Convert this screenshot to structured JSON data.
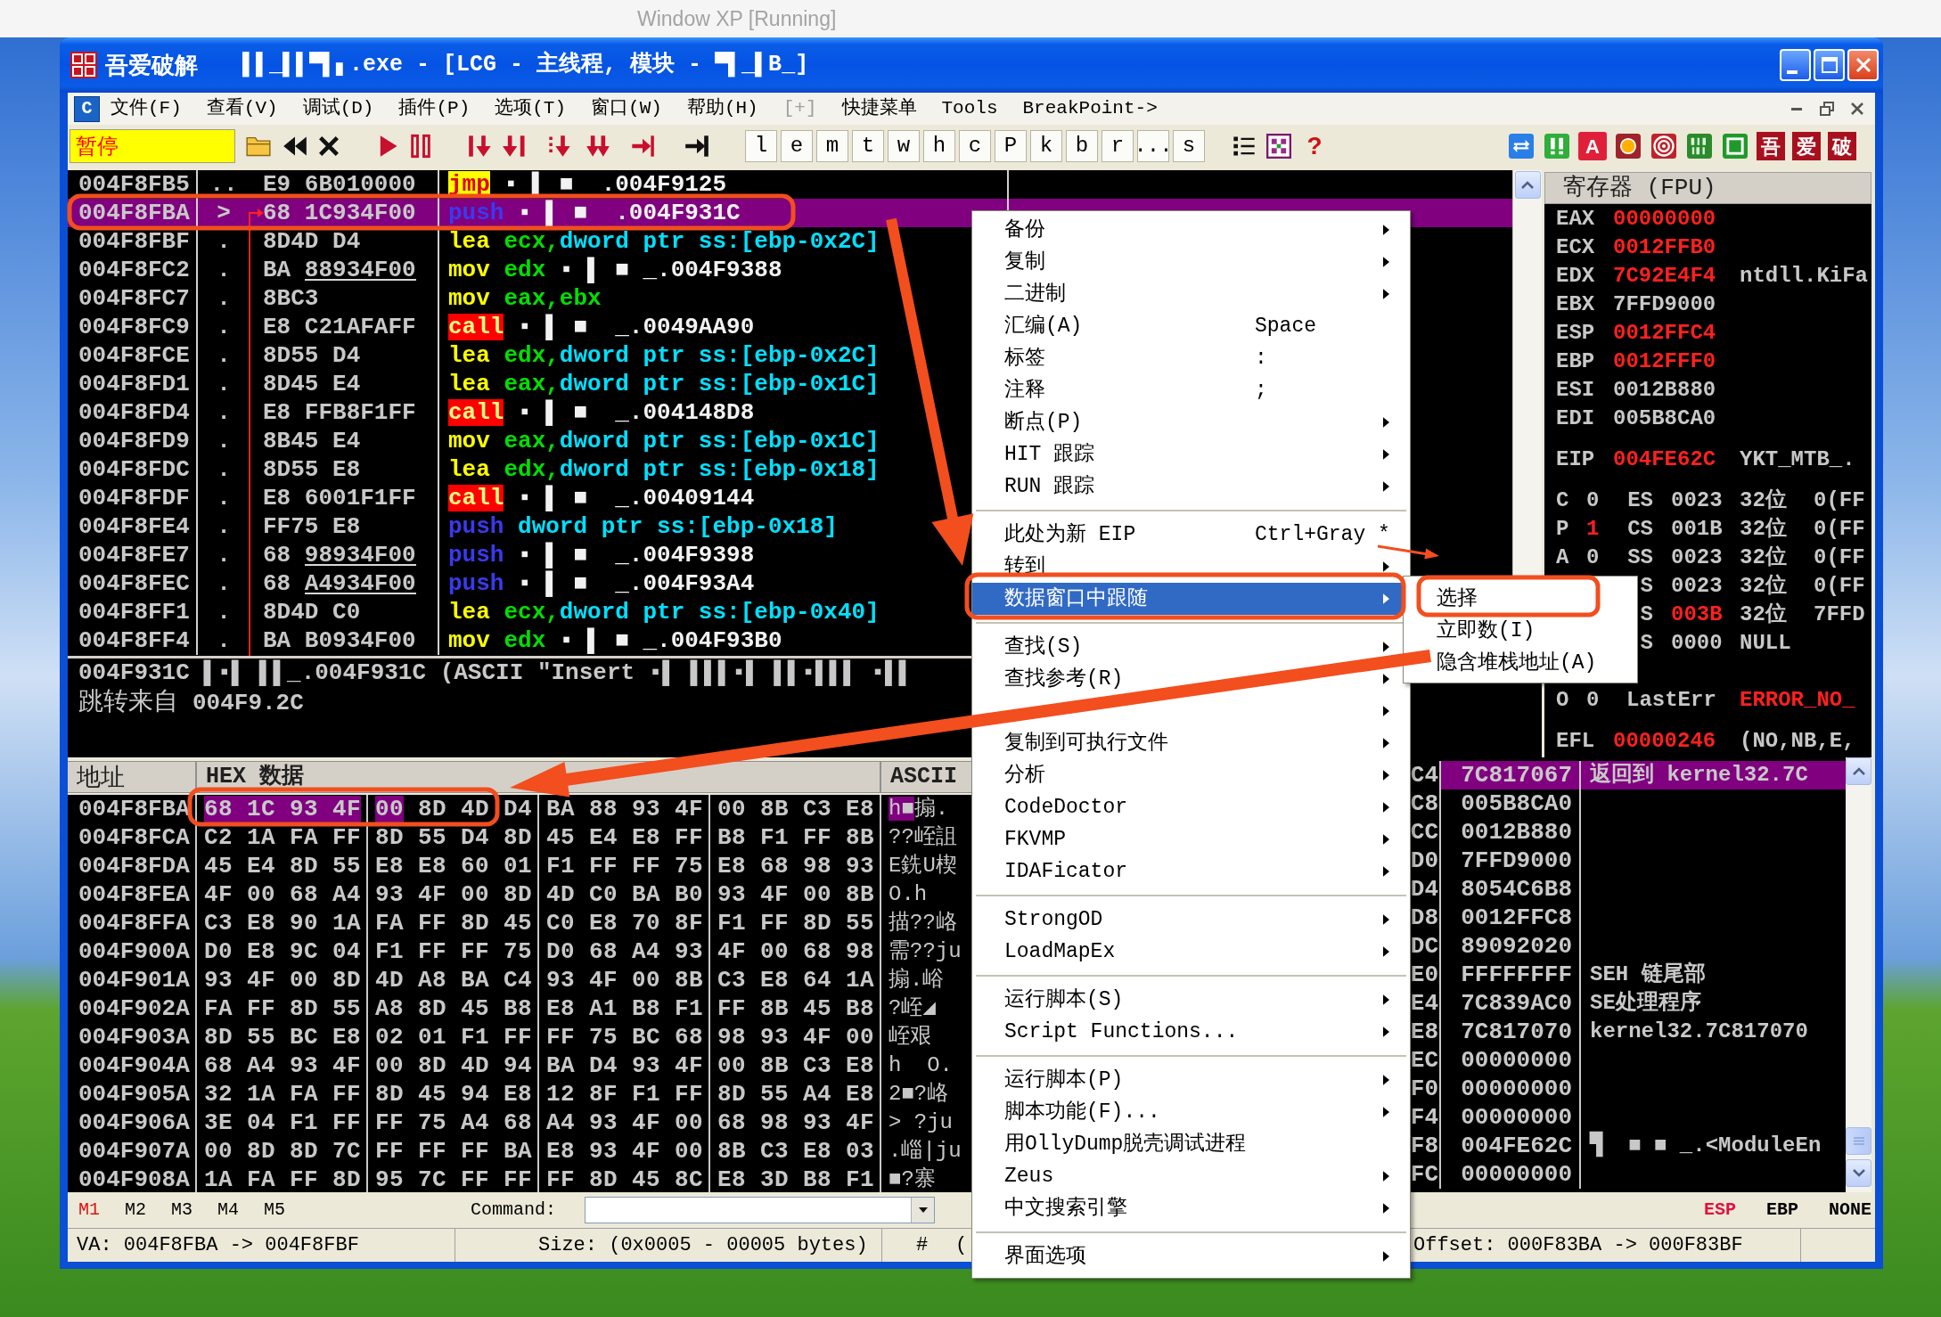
{
  "host": {
    "title": "Window XP [Running]"
  },
  "window": {
    "app": "吾爱破解",
    "title": "▌▌_▌▌▀▌▖.exe - [LCG - 主线程, 模块 - ▀▌_▌B_]"
  },
  "menu_bar": {
    "child_icon": "C",
    "items": [
      {
        "label": "文件(F)",
        "disabled": false
      },
      {
        "label": "查看(V)",
        "disabled": false
      },
      {
        "label": "调试(D)",
        "disabled": false
      },
      {
        "label": "插件(P)",
        "disabled": false
      },
      {
        "label": "选项(T)",
        "disabled": false
      },
      {
        "label": "窗口(W)",
        "disabled": false
      },
      {
        "label": "帮助(H)",
        "disabled": false
      },
      {
        "label": "[+]",
        "disabled": true
      },
      {
        "label": "快捷菜单",
        "disabled": false
      },
      {
        "label": "Tools",
        "disabled": false
      },
      {
        "label": "BreakPoint->",
        "disabled": false
      }
    ]
  },
  "toolbar": {
    "status": "暂停",
    "letters": [
      "l",
      "e",
      "m",
      "t",
      "w",
      "h",
      "c",
      "P",
      "k",
      "b",
      "r",
      "...",
      "s"
    ],
    "help": "?",
    "label_tile": "A",
    "logo_tiles": [
      "吾",
      "爱",
      "破"
    ]
  },
  "disassembly": {
    "rows": [
      {
        "address": "004F8FB5",
        "marker": "..",
        "opcode": "E9",
        "operand": "6B010000",
        "relocated": false,
        "selected": false,
        "parts": [
          {
            "text": "jmp",
            "kind": "jump"
          },
          {
            "text": "▪ ▌ ■  .004F9125",
            "kind": "address"
          }
        ]
      },
      {
        "address": "004F8FBA",
        "marker": ">",
        "opcode": "68",
        "operand": "1C934F00",
        "relocated": false,
        "selected": true,
        "parts": [
          {
            "text": "push",
            "kind": "push"
          },
          {
            "text": "▪ ▌ ■  .004F931C",
            "kind": "address"
          }
        ]
      },
      {
        "address": "004F8FBF",
        "marker": ".",
        "opcode": "8D4D",
        "operand": "D4",
        "relocated": false,
        "selected": false,
        "parts": [
          {
            "text": "lea",
            "kind": "move"
          },
          {
            "text": "ecx,",
            "kind": "register"
          },
          {
            "text": "dword ptr ss:[ebp-0x2C]",
            "kind": "memory"
          }
        ]
      },
      {
        "address": "004F8FC2",
        "marker": ".",
        "opcode": "BA",
        "operand": "88934F00",
        "relocated": true,
        "selected": false,
        "parts": [
          {
            "text": "mov",
            "kind": "move"
          },
          {
            "text": "edx",
            "kind": "register"
          },
          {
            "text": "▪ ▌ ■ _.004F9388",
            "kind": "address"
          }
        ]
      },
      {
        "address": "004F8FC7",
        "marker": ".",
        "opcode": "8BC3",
        "selected": false,
        "parts": [
          {
            "text": "mov",
            "kind": "move"
          },
          {
            "text": "eax,ebx",
            "kind": "register"
          }
        ]
      },
      {
        "address": "004F8FC9",
        "marker": ".",
        "opcode": "E8",
        "operand": "C21AFAFF",
        "relocated": false,
        "selected": false,
        "parts": [
          {
            "text": "call",
            "kind": "call"
          },
          {
            "text": "▪ ▌ ■  _.0049AA90",
            "kind": "address"
          }
        ]
      },
      {
        "address": "004F8FCE",
        "marker": ".",
        "opcode": "8D55",
        "operand": "D4",
        "relocated": false,
        "selected": false,
        "parts": [
          {
            "text": "lea",
            "kind": "move"
          },
          {
            "text": "edx,",
            "kind": "register"
          },
          {
            "text": "dword ptr ss:[ebp-0x2C]",
            "kind": "memory"
          }
        ]
      },
      {
        "address": "004F8FD1",
        "marker": ".",
        "opcode": "8D45",
        "operand": "E4",
        "relocated": false,
        "selected": false,
        "parts": [
          {
            "text": "lea",
            "kind": "move"
          },
          {
            "text": "eax,",
            "kind": "register"
          },
          {
            "text": "dword ptr ss:[ebp-0x1C]",
            "kind": "memory"
          }
        ]
      },
      {
        "address": "004F8FD4",
        "marker": ".",
        "opcode": "E8",
        "operand": "FFB8F1FF",
        "relocated": false,
        "selected": false,
        "parts": [
          {
            "text": "call",
            "kind": "call"
          },
          {
            "text": "▪ ▌ ■  _.004148D8",
            "kind": "address"
          }
        ]
      },
      {
        "address": "004F8FD9",
        "marker": ".",
        "opcode": "8B45",
        "operand": "E4",
        "relocated": false,
        "selected": false,
        "parts": [
          {
            "text": "mov",
            "kind": "move"
          },
          {
            "text": "eax,",
            "kind": "register"
          },
          {
            "text": "dword ptr ss:[ebp-0x1C]",
            "kind": "memory"
          }
        ]
      },
      {
        "address": "004F8FDC",
        "marker": ".",
        "opcode": "8D55",
        "operand": "E8",
        "relocated": false,
        "selected": false,
        "parts": [
          {
            "text": "lea",
            "kind": "move"
          },
          {
            "text": "edx,",
            "kind": "register"
          },
          {
            "text": "dword ptr ss:[ebp-0x18]",
            "kind": "memory"
          }
        ]
      },
      {
        "address": "004F8FDF",
        "marker": ".",
        "opcode": "E8",
        "operand": "6001F1FF",
        "relocated": false,
        "selected": false,
        "parts": [
          {
            "text": "call",
            "kind": "call"
          },
          {
            "text": "▪ ▌ ■  _.00409144",
            "kind": "address"
          }
        ]
      },
      {
        "address": "004F8FE4",
        "marker": ".",
        "opcode": "FF75",
        "operand": "E8",
        "relocated": false,
        "selected": false,
        "parts": [
          {
            "text": "push",
            "kind": "push"
          },
          {
            "text": "dword ptr ss:[ebp-0x18]",
            "kind": "memory"
          }
        ]
      },
      {
        "address": "004F8FE7",
        "marker": ".",
        "opcode": "68",
        "operand": "98934F00",
        "relocated": true,
        "selected": false,
        "parts": [
          {
            "text": "push",
            "kind": "push"
          },
          {
            "text": "▪ ▌ ■  _.004F9398",
            "kind": "address"
          }
        ]
      },
      {
        "address": "004F8FEC",
        "marker": ".",
        "opcode": "68",
        "operand": "A4934F00",
        "relocated": true,
        "selected": false,
        "parts": [
          {
            "text": "push",
            "kind": "push"
          },
          {
            "text": "▪ ▌ ■  _.004F93A4",
            "kind": "address"
          }
        ]
      },
      {
        "address": "004F8FF1",
        "marker": ".",
        "opcode": "8D4D",
        "operand": "C0",
        "relocated": false,
        "selected": false,
        "parts": [
          {
            "text": "lea",
            "kind": "move"
          },
          {
            "text": "ecx,",
            "kind": "register"
          },
          {
            "text": "dword ptr ss:[ebp-0x40]",
            "kind": "memory"
          }
        ]
      },
      {
        "address": "004F8FF4",
        "marker": ".",
        "opcode": "BA",
        "operand": "B0934F00",
        "relocated": false,
        "selected": false,
        "parts": [
          {
            "text": "mov",
            "kind": "move"
          },
          {
            "text": "edx",
            "kind": "register"
          },
          {
            "text": "▪ ▌ ■ _.004F93B0",
            "kind": "address"
          }
        ]
      }
    ]
  },
  "info": {
    "line": "004F931C ▌▪▌ ▌▌_.004F931C (ASCII \"Insert ▪▌ ▌▌▌▪▌ ▌▌▪▌▌▌ ▪▌▌",
    "jump_label": "跳转来自",
    "jump_value": "004F9.2C"
  },
  "registers": {
    "title": "寄存器 (FPU)",
    "general": [
      {
        "name": "EAX",
        "value": "00000000",
        "changed": true
      },
      {
        "name": "ECX",
        "value": "0012FFB0",
        "changed": true
      },
      {
        "name": "EDX",
        "value": "7C92E4F4",
        "changed": true,
        "comment": "ntdll.KiFa"
      },
      {
        "name": "EBX",
        "value": "7FFD9000",
        "changed": false
      },
      {
        "name": "ESP",
        "value": "0012FFC4",
        "changed": true
      },
      {
        "name": "EBP",
        "value": "0012FFF0",
        "changed": true
      },
      {
        "name": "ESI",
        "value": "0012B880",
        "changed": false
      },
      {
        "name": "EDI",
        "value": "005B8CA0",
        "changed": false
      }
    ],
    "eip": {
      "name": "EIP",
      "value": "004FE62C",
      "changed": true,
      "comment": "YKT_MTB_."
    },
    "flags": [
      {
        "flag": "C",
        "flag_value": "0",
        "flag_changed": false,
        "segment": "ES",
        "selector": "0023",
        "selector_changed": false,
        "info": "32位",
        "base": "0(FF"
      },
      {
        "flag": "P",
        "flag_value": "1",
        "flag_changed": true,
        "segment": "CS",
        "selector": "001B",
        "selector_changed": false,
        "info": "32位",
        "base": "0(FF"
      },
      {
        "flag": "A",
        "flag_value": "0",
        "flag_changed": false,
        "segment": "SS",
        "selector": "0023",
        "selector_changed": false,
        "info": "32位",
        "base": "0(FF"
      },
      {
        "segment": "S",
        "selector": "0023",
        "selector_changed": false,
        "info": "32位",
        "base": "0(FF"
      },
      {
        "segment": "S",
        "selector": "003B",
        "selector_changed": true,
        "info": "32位",
        "base": "7FFD"
      },
      {
        "segment": "S",
        "selector": "0000",
        "selector_changed": false,
        "info": "NULL"
      }
    ],
    "last_error": {
      "flag": "O",
      "flag_value": "0",
      "flag_changed": false,
      "label": "LastErr",
      "value": "ERROR_NO_",
      "changed": true
    },
    "efl": {
      "name": "EFL",
      "value": "00000246",
      "changed": true,
      "comment": "(NO,NB,E,"
    }
  },
  "hex_dump": {
    "columns": [
      "地址",
      "HEX 数据",
      "ASCII"
    ],
    "rows": [
      {
        "address": "004F8FBA",
        "selected_bytes": [
          "68",
          "1C",
          "93",
          "4F",
          "00"
        ],
        "bytes": [
          "8D",
          "4D",
          "D4",
          "BA",
          "88",
          "93",
          "4F",
          "00",
          "8B",
          "C3",
          "E8"
        ],
        "selected_ascii": "h■",
        "ascii": "搧."
      },
      {
        "address": "004F8FCA",
        "bytes": [
          "C2",
          "1A",
          "FA",
          "FF",
          "8D",
          "55",
          "D4",
          "8D",
          "45",
          "E4",
          "E8",
          "FF",
          "B8",
          "F1",
          "FF",
          "8B"
        ],
        "ascii": "??峌詛"
      },
      {
        "address": "004F8FDA",
        "bytes": [
          "45",
          "E4",
          "8D",
          "55",
          "E8",
          "E8",
          "60",
          "01",
          "F1",
          "FF",
          "FF",
          "75",
          "E8",
          "68",
          "98",
          "93"
        ],
        "ascii": "E銑U楔"
      },
      {
        "address": "004F8FEA",
        "bytes": [
          "4F",
          "00",
          "68",
          "A4",
          "93",
          "4F",
          "00",
          "8D",
          "4D",
          "C0",
          "BA",
          "B0",
          "93",
          "4F",
          "00",
          "8B"
        ],
        "ascii": "O.h"
      },
      {
        "address": "004F8FFA",
        "bytes": [
          "C3",
          "E8",
          "90",
          "1A",
          "FA",
          "FF",
          "8D",
          "45",
          "C0",
          "E8",
          "70",
          "8F",
          "F1",
          "FF",
          "8D",
          "55"
        ],
        "ascii": "描??峈"
      },
      {
        "address": "004F900A",
        "bytes": [
          "D0",
          "E8",
          "9C",
          "04",
          "F1",
          "FF",
          "FF",
          "75",
          "D0",
          "68",
          "A4",
          "93",
          "4F",
          "00",
          "68",
          "98"
        ],
        "ascii": "需??ju"
      },
      {
        "address": "004F901A",
        "bytes": [
          "93",
          "4F",
          "00",
          "8D",
          "4D",
          "A8",
          "BA",
          "C4",
          "93",
          "4F",
          "00",
          "8B",
          "C3",
          "E8",
          "64",
          "1A"
        ],
        "ascii": "搧.峪"
      },
      {
        "address": "004F902A",
        "bytes": [
          "FA",
          "FF",
          "8D",
          "55",
          "A8",
          "8D",
          "45",
          "B8",
          "E8",
          "A1",
          "B8",
          "F1",
          "FF",
          "8B",
          "45",
          "B8"
        ],
        "ascii": "?峌◢"
      },
      {
        "address": "004F903A",
        "bytes": [
          "8D",
          "55",
          "BC",
          "E8",
          "02",
          "01",
          "F1",
          "FF",
          "FF",
          "75",
          "BC",
          "68",
          "98",
          "93",
          "4F",
          "00"
        ],
        "ascii": "峌艰"
      },
      {
        "address": "004F904A",
        "bytes": [
          "68",
          "A4",
          "93",
          "4F",
          "00",
          "8D",
          "4D",
          "94",
          "BA",
          "D4",
          "93",
          "4F",
          "00",
          "8B",
          "C3",
          "E8"
        ],
        "ascii": "h  O."
      },
      {
        "address": "004F905A",
        "bytes": [
          "32",
          "1A",
          "FA",
          "FF",
          "8D",
          "45",
          "94",
          "E8",
          "12",
          "8F",
          "F1",
          "FF",
          "8D",
          "55",
          "A4",
          "E8"
        ],
        "ascii": "2■?峈"
      },
      {
        "address": "004F906A",
        "bytes": [
          "3E",
          "04",
          "F1",
          "FF",
          "FF",
          "75",
          "A4",
          "68",
          "A4",
          "93",
          "4F",
          "00",
          "68",
          "98",
          "93",
          "4F"
        ],
        "ascii": "> ?ju"
      },
      {
        "address": "004F907A",
        "bytes": [
          "00",
          "8D",
          "8D",
          "7C",
          "FF",
          "FF",
          "FF",
          "BA",
          "E8",
          "93",
          "4F",
          "00",
          "8B",
          "C3",
          "E8",
          "03"
        ],
        "ascii": ".崰|ju"
      },
      {
        "address": "004F908A",
        "bytes": [
          "1A",
          "FA",
          "FF",
          "8D",
          "95",
          "7C",
          "FF",
          "FF",
          "FF",
          "8D",
          "45",
          "8C",
          "E8",
          "3D",
          "B8",
          "F1"
        ],
        "ascii": "■?寨"
      }
    ]
  },
  "stack": {
    "rows": [
      {
        "address": "C4",
        "value": "7C817067",
        "comment": "返回到 kernel32.7C",
        "selected": true
      },
      {
        "address": "C8",
        "value": "005B8CA0",
        "selected": false
      },
      {
        "address": "CC",
        "value": "0012B880",
        "selected": false
      },
      {
        "address": "D0",
        "value": "7FFD9000",
        "selected": false
      },
      {
        "address": "D4",
        "value": "8054C6B8",
        "selected": false
      },
      {
        "address": "D8",
        "value": "0012FFC8",
        "selected": false
      },
      {
        "address": "DC",
        "value": "89092020",
        "selected": false
      },
      {
        "address": "E0",
        "value": "FFFFFFFF",
        "comment": "SEH 链尾部",
        "selected": false
      },
      {
        "address": "E4",
        "value": "7C839AC0",
        "comment": "SE处理程序",
        "selected": false
      },
      {
        "address": "E8",
        "value": "7C817070",
        "comment": "kernel32.7C817070",
        "selected": false
      },
      {
        "address": "EC",
        "value": "00000000",
        "selected": false
      },
      {
        "address": "F0",
        "value": "00000000",
        "selected": false
      },
      {
        "address": "F4",
        "value": "00000000",
        "selected": false
      },
      {
        "address": "F8",
        "value": "004FE62C",
        "comment": "▜  ■ ■ _.<ModuleEn",
        "selected": false
      },
      {
        "address": "FC",
        "value": "00000000",
        "selected": false
      }
    ]
  },
  "command_bar": {
    "marks": [
      {
        "label": "M1",
        "selected": true
      },
      {
        "label": "M2",
        "selected": false
      },
      {
        "label": "M3",
        "selected": false
      },
      {
        "label": "M4",
        "selected": false
      },
      {
        "label": "M5",
        "selected": false
      }
    ],
    "label": "Command:",
    "modes": [
      {
        "label": "ESP",
        "selected": true
      },
      {
        "label": "EBP",
        "selected": false
      },
      {
        "label": "NONE",
        "selected": false
      }
    ]
  },
  "status_bar": {
    "fields": [
      "VA: 004F8FBA -> 004F8FBF",
      "Size: (0x0005 - 00005 bytes)",
      "#",
      "(",
      "Offset: 000F83BA -> 000F83BF"
    ]
  },
  "context_menu": {
    "groups": [
      {
        "items": [
          {
            "label": "备份",
            "submenu": true,
            "selected": false
          },
          {
            "label": "复制",
            "submenu": true,
            "selected": false
          },
          {
            "label": "二进制",
            "submenu": true,
            "selected": false
          },
          {
            "label": "汇编(A)",
            "shortcut": "Space",
            "submenu": false,
            "selected": false
          },
          {
            "label": "标签",
            "shortcut": ":",
            "submenu": false,
            "selected": false
          },
          {
            "label": "注释",
            "shortcut": ";",
            "submenu": false,
            "selected": false
          },
          {
            "label": "断点(P)",
            "submenu": true,
            "selected": false
          },
          {
            "label": "HIT 跟踪",
            "submenu": true,
            "selected": false
          },
          {
            "label": "RUN 跟踪",
            "submenu": true,
            "selected": false
          }
        ]
      },
      {
        "items": [
          {
            "label": "此处为新 EIP",
            "shortcut": "Ctrl+Gray *",
            "submenu": false,
            "selected": false
          },
          {
            "label": "转到",
            "submenu": true,
            "selected": false
          },
          {
            "label": "数据窗口中跟随",
            "submenu": true,
            "selected": true
          }
        ]
      },
      {
        "items": [
          {
            "label": "查找(S)",
            "submenu": true,
            "selected": false
          },
          {
            "label": "查找参考(R)",
            "submenu": true,
            "selected": false
          },
          {
            "submenu": true,
            "selected": false
          },
          {
            "label": "复制到可执行文件",
            "submenu": true,
            "selected": false
          },
          {
            "label": "分析",
            "submenu": true,
            "selected": false
          },
          {
            "label": "CodeDoctor",
            "submenu": true,
            "selected": false
          },
          {
            "label": "FKVMP",
            "submenu": true,
            "selected": false
          },
          {
            "label": "IDAFicator",
            "submenu": true,
            "selected": false
          }
        ]
      },
      {
        "items": [
          {
            "label": "StrongOD",
            "submenu": true,
            "selected": false
          },
          {
            "label": "LoadMapEx",
            "submenu": true,
            "selected": false
          }
        ]
      },
      {
        "items": [
          {
            "label": "运行脚本(S)",
            "submenu": true,
            "selected": false
          },
          {
            "label": "Script Functions...",
            "submenu": true,
            "selected": false
          }
        ]
      },
      {
        "items": [
          {
            "label": "运行脚本(P)",
            "submenu": true,
            "selected": false
          },
          {
            "label": "脚本功能(F)...",
            "submenu": true,
            "selected": false
          },
          {
            "label": "用OllyDump脱壳调试进程",
            "submenu": false,
            "selected": false
          },
          {
            "label": "Zeus",
            "submenu": true,
            "selected": false
          },
          {
            "label": "中文搜索引擎",
            "submenu": true,
            "selected": false
          }
        ]
      },
      {
        "items": [
          {
            "label": "界面选项",
            "submenu": true,
            "selected": false
          }
        ]
      }
    ]
  },
  "submenu": {
    "items": [
      {
        "label": "选择",
        "selected": false
      },
      {
        "label": "立即数(I)",
        "selected": false
      },
      {
        "label": "隐含堆栈地址(A)",
        "selected": false
      }
    ]
  }
}
